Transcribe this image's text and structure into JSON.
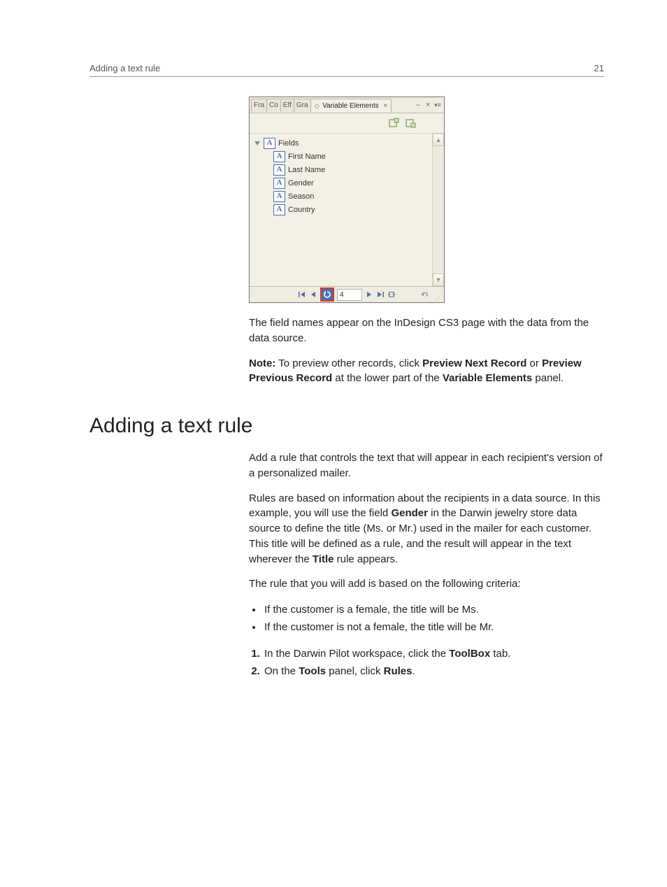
{
  "header": {
    "title": "Adding a text rule",
    "page_number": "21"
  },
  "panel": {
    "tabs": {
      "t1": "Fra",
      "t2": "Co",
      "t3": "Eff",
      "t4": "Gra",
      "active_prefix": "◇",
      "active_label": "Variable Elements",
      "close_glyph": "×"
    },
    "tree": {
      "root": "Fields",
      "items": [
        "First Name",
        "Last Name",
        "Gender",
        "Season",
        "Country"
      ]
    },
    "nav": {
      "page_value": "4"
    }
  },
  "body": {
    "p1a": "The field names appear on the InDesign CS3 page with the data from the data source.",
    "note_label": "Note:",
    "note_a": " To preview other records, click ",
    "note_b1": "Preview Next Record",
    "note_c": " or ",
    "note_b2": "Preview Previous Record",
    "note_d": " at the lower part of the ",
    "note_b3": "Variable Elements",
    "note_e": " panel."
  },
  "section": {
    "heading": "Adding a text rule",
    "p1": "Add a rule that controls the text that will appear in each recipient's version of a personalized mailer.",
    "p2a": "Rules are based on information about the recipients in a data source. In this example, you will use the field ",
    "p2b1": "Gender",
    "p2c": " in the Darwin jewelry store data source to define the title (Ms. or Mr.) used in the mailer for each customer. This title will be defined as a rule, and the result will appear in the text wherever the ",
    "p2b2": "Title",
    "p2d": " rule appears.",
    "p3": "The rule that you will add is based on the following criteria:",
    "bullets": [
      "If the customer is a female, the title will be Ms.",
      "If the customer is not a female, the title will be Mr."
    ],
    "step1a": "In the Darwin Pilot workspace, click the ",
    "step1b": "ToolBox",
    "step1c": " tab.",
    "step2a": "On the ",
    "step2b1": "Tools",
    "step2c": " panel, click ",
    "step2b2": "Rules",
    "step2d": "."
  }
}
